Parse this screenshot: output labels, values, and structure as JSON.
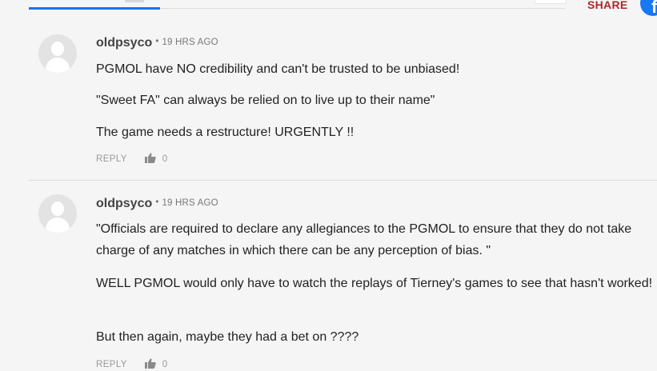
{
  "header": {
    "share_label": "SHARE",
    "facebook_icon": "facebook-icon"
  },
  "comments": [
    {
      "author": "oldpsyco",
      "time": "19 HRS AGO",
      "paragraphs": [
        "PGMOL have NO credibility and can't be trusted to be unbiased!",
        "\"Sweet FA\" can always be relied on to live up to their name\"",
        "The game needs a restructure! URGENTLY !!"
      ],
      "reply_label": "REPLY",
      "likes": "0"
    },
    {
      "author": "oldpsyco",
      "time": "19 HRS AGO",
      "paragraphs": [
        "\"Officials are required to declare any allegiances to the PGMOL to ensure that they do not take charge of any matches in which there can be any perception of bias. \"",
        "WELL PGMOL would only have to watch the replays of Tierney's games to see that hasn't worked!",
        "But then again, maybe they had a bet on ????"
      ],
      "reply_label": "REPLY",
      "likes": "0"
    }
  ],
  "colors": {
    "accent_tab": "#1a73e8",
    "share_red": "#b0262b",
    "facebook_blue": "#1877f2"
  }
}
